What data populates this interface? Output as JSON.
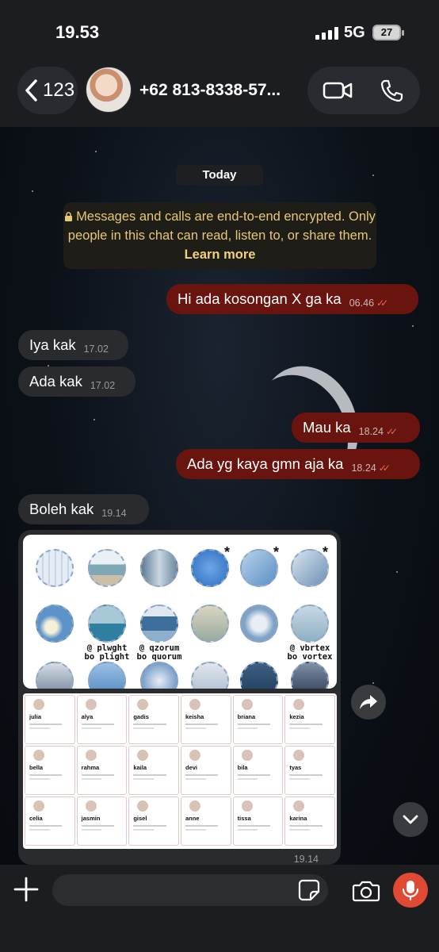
{
  "status_bar": {
    "time": "19.53",
    "network": "5G",
    "battery": "27"
  },
  "header": {
    "back_count": "123",
    "contact_name": "+62 813-8338-57...",
    "icons": {
      "back": "chevron-left-icon",
      "video": "video-camera-icon",
      "phone": "phone-icon"
    }
  },
  "chat": {
    "date_label": "Today",
    "encryption_notice": {
      "text": "Messages and calls are end-to-end encrypted. Only people in this chat can read, listen to, or share them.",
      "link": "Learn more"
    },
    "messages": [
      {
        "direction": "outgoing",
        "text": "Hi ada kosongan X ga ka",
        "time": "06.46",
        "read": true
      },
      {
        "direction": "incoming",
        "text": "Iya kak",
        "time": "17.02"
      },
      {
        "direction": "incoming",
        "text": "Ada kak",
        "time": "17.02"
      },
      {
        "direction": "outgoing",
        "text": "Mau ka",
        "time": "18.24",
        "read": true
      },
      {
        "direction": "outgoing",
        "text": "Ada yg kaya gmn aja ka",
        "time": "18.24",
        "read": true
      },
      {
        "direction": "incoming",
        "text": "Boleh kak",
        "time": "19.14"
      }
    ],
    "media_message": {
      "time": "19.14",
      "image1_labels": [
        "@ plwght",
        "bo plight",
        "@ qzorum",
        "bo quorum",
        "@ vbrtex",
        "bo vortex"
      ],
      "image2_profiles": [
        "julia",
        "alya",
        "gadis",
        "keisha",
        "briana",
        "kezia",
        "bella",
        "rahma",
        "kaila",
        "devi",
        "bila",
        "tyas",
        "celia",
        "jasmin",
        "gisel",
        "anne",
        "tissa",
        "karina"
      ]
    }
  },
  "composer": {
    "placeholder": "",
    "icons": {
      "add": "plus-icon",
      "sticker": "sticker-icon",
      "camera": "camera-icon",
      "mic": "microphone-icon"
    }
  },
  "colors": {
    "outgoing_bubble": "#6a1410",
    "incoming_bubble": "#2a2b2f",
    "mic_button": "#e04a35",
    "encryption_text": "#e6c875"
  }
}
